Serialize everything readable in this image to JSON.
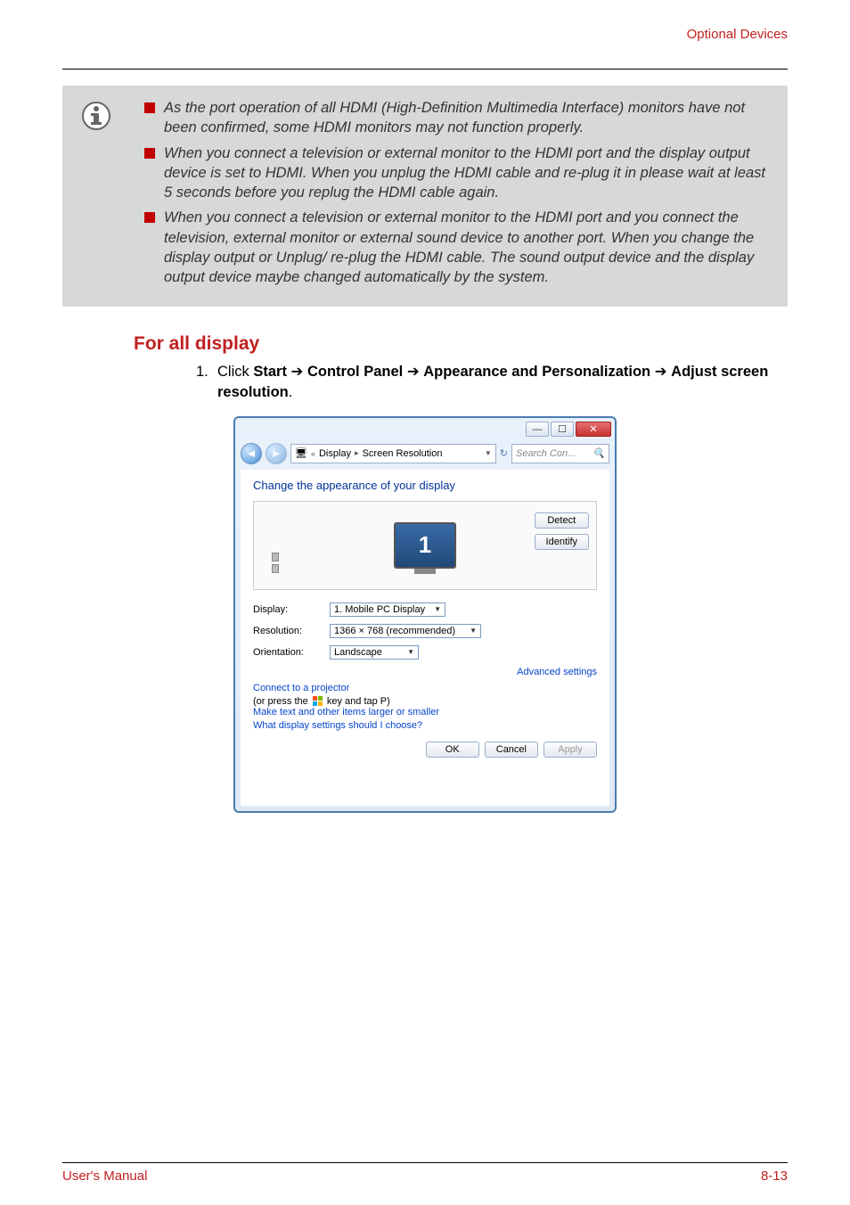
{
  "header": {
    "section_link": "Optional Devices"
  },
  "note": {
    "items": [
      "As the port operation of all HDMI (High-Definition Multimedia Interface) monitors have not been confirmed, some HDMI monitors may not function properly.",
      "When you connect a television or external monitor to the HDMI port and the display output device is set to HDMI. When you unplug the HDMI cable and re-plug it in please wait at least 5 seconds before you replug the HDMI cable again.",
      "When you connect a television or external monitor to the HDMI port and you connect the television, external monitor or external sound device to another port. When you change the display output or Unplug/ re-plug the HDMI cable. The sound output device and the display output device maybe changed automatically by the system."
    ]
  },
  "section": {
    "title": "For all display",
    "step_number": "1.",
    "step_prefix": "Click ",
    "pieces": [
      "Start",
      "Control Panel",
      "Appearance and Personalization",
      "Adjust screen resolution"
    ]
  },
  "screenshot": {
    "breadcrumb": {
      "sep1": "«",
      "item1": "Display",
      "sep2": "▸",
      "item2": "Screen Resolution"
    },
    "search_placeholder": "Search Con...",
    "heading": "Change the appearance of your display",
    "buttons": {
      "detect": "Detect",
      "identify": "Identify",
      "ok": "OK",
      "cancel": "Cancel",
      "apply": "Apply"
    },
    "monitor_number": "1",
    "rows": {
      "display_label": "Display:",
      "display_value": "1. Mobile PC Display",
      "resolution_label": "Resolution:",
      "resolution_value": "1366 × 768 (recommended)",
      "orientation_label": "Orientation:",
      "orientation_value": "Landscape"
    },
    "links": {
      "advanced": "Advanced settings",
      "projector_pre": "Connect to a projector",
      "projector_post": " (or press the ",
      "projector_tail": " key and tap P)",
      "textsize": "Make text and other items larger or smaller",
      "help": "What display settings should I choose?"
    }
  },
  "footer": {
    "left": "User's Manual",
    "right": "8-13"
  }
}
